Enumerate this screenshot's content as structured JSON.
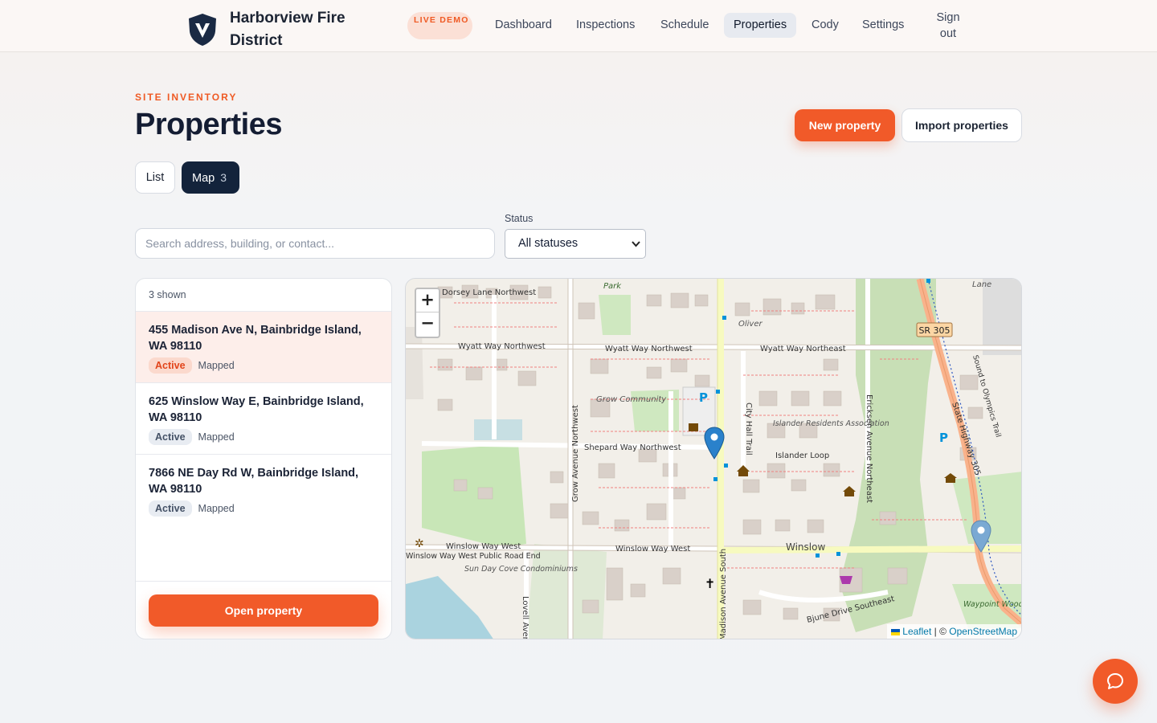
{
  "brand": {
    "name": "Harborview Fire District",
    "badge": "LIVE DEMO"
  },
  "nav": {
    "items": [
      {
        "label": "Dashboard",
        "active": false
      },
      {
        "label": "Inspections",
        "active": false
      },
      {
        "label": "Schedule",
        "active": false
      },
      {
        "label": "Properties",
        "active": true
      },
      {
        "label": "Cody",
        "active": false
      },
      {
        "label": "Settings",
        "active": false
      }
    ],
    "signout": "Sign out"
  },
  "header": {
    "eyebrow": "SITE INVENTORY",
    "title": "Properties",
    "new_button": "New property",
    "import_button": "Import properties"
  },
  "view_toggle": {
    "list_label": "List",
    "map_label": "Map",
    "map_count": "3",
    "active": "Map"
  },
  "filters": {
    "search_placeholder": "Search address, building, or contact...",
    "search_value": "",
    "status_label": "Status",
    "status_selected": "All statuses"
  },
  "list": {
    "count_text": "3 shown",
    "items": [
      {
        "address": "455 Madison Ave N, Bainbridge Island, WA 98110",
        "status": "Active",
        "mapped": "Mapped",
        "selected": true
      },
      {
        "address": "625 Winslow Way E, Bainbridge Island, WA 98110",
        "status": "Active",
        "mapped": "Mapped",
        "selected": false
      },
      {
        "address": "7866 NE Day Rd W, Bainbridge Island, WA 98110",
        "status": "Active",
        "mapped": "Mapped",
        "selected": false
      }
    ],
    "open_button": "Open property"
  },
  "map": {
    "zoom_in": "+",
    "zoom_out": "−",
    "attribution_leaflet": "Leaflet",
    "attribution_sep": "| ©",
    "attribution_osm": "OpenStreetMap",
    "labels": {
      "dorsey": "Dorsey Lane Northwest",
      "park": "Park",
      "oliver": "Oliver",
      "wyatt_w": "Wyatt Way Northwest",
      "wyatt_w2": "Wyatt Way Northwest",
      "wyatt_e": "Wyatt Way Northeast",
      "sr305": "SR 305",
      "lane": "Lane",
      "grow_community": "Grow Community",
      "shepard": "Shepard Way Northwest",
      "grow_ave": "Grow Avenue Northwest",
      "city_hall": "City Hall Trail",
      "islander": "Islander Residents Association",
      "islander_loop": "Islander Loop",
      "ericksen": "Ericksen Avenue Northeast",
      "highway": "State Highway 305",
      "sound_olympics": "Sound to Olympics Trail",
      "winslow_w": "Winslow Way West",
      "winslow_w2": "Winslow Way West",
      "winslow": "Winslow",
      "public_road_end": "Winslow Way West Public Road End",
      "sunday": "Sun Day Cove Condominiums",
      "lovell": "Lovell Avenue",
      "madison_s": "Madison Avenue South",
      "bjune": "Bjune Drive Southeast",
      "waypoint": "Waypoint Woods",
      "parking": "P"
    },
    "pin_active_color": "#2a81cb",
    "pin_inactive_color": "#7aa9d3"
  },
  "chat": {
    "icon": "chat-bubble-icon"
  },
  "colors": {
    "accent": "#f15a29",
    "navy": "#13233b"
  }
}
